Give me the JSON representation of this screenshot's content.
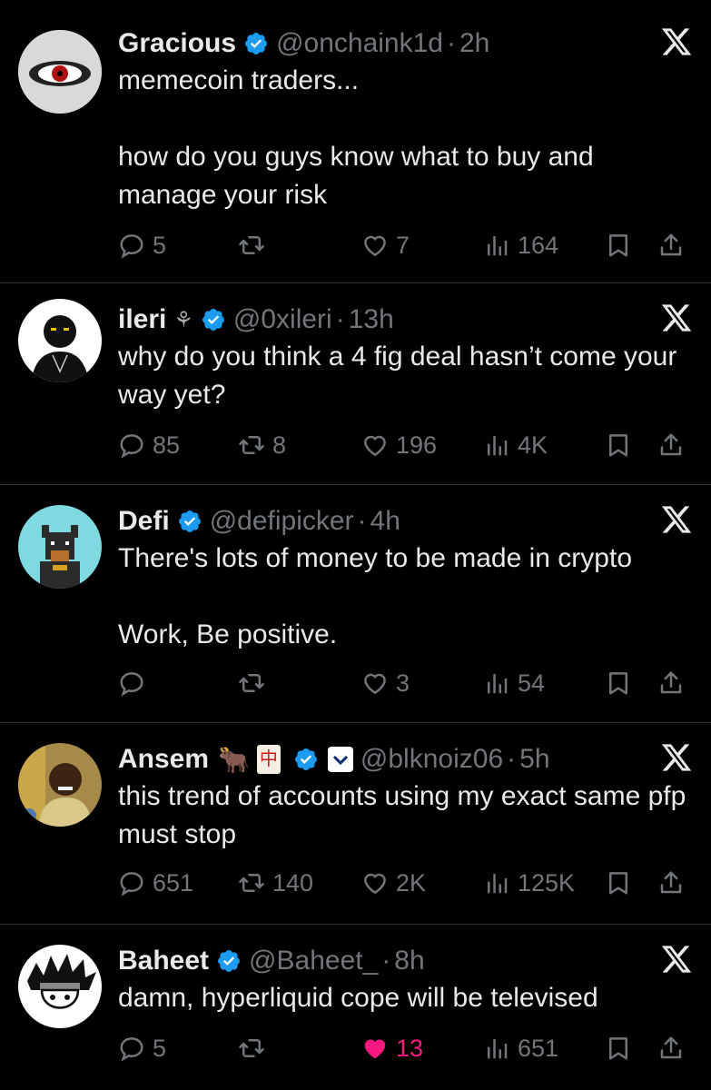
{
  "tweets": [
    {
      "name": "Gracious",
      "handle": "@onchaink1d",
      "time": "2h",
      "body": "memecoin traders...\n\nhow do you guys know what to buy and manage your risk",
      "replies": "5",
      "reposts": "",
      "likes": "7",
      "views": "164",
      "liked": false
    },
    {
      "name": "ileri",
      "handle": "@0xileri",
      "time": "13h",
      "body": "why do you think a 4 fig deal hasn’t come your way yet?",
      "replies": "85",
      "reposts": "8",
      "likes": "196",
      "views": "4K",
      "liked": false
    },
    {
      "name": "Defi",
      "handle": "@defipicker",
      "time": "4h",
      "body": "There's lots of money to be made in crypto\n\nWork, Be positive.",
      "replies": "",
      "reposts": "",
      "likes": "3",
      "views": "54",
      "liked": false
    },
    {
      "name": "Ansem",
      "handle": "@blknoiz06",
      "time": "5h",
      "body": "this trend of accounts using my exact same pfp must stop",
      "replies": "651",
      "reposts": "140",
      "likes": "2K",
      "views": "125K",
      "liked": false
    },
    {
      "name": "Baheet",
      "handle": "@Baheet_",
      "time": "8h",
      "body": "damn, hyperliquid cope will be televised",
      "replies": "5",
      "reposts": "",
      "likes": "13",
      "views": "651",
      "liked": true
    }
  ],
  "colors": {
    "background": "#000000",
    "text": "#e7e9ea",
    "muted": "#71767b",
    "verified": "#1d9bf0",
    "like": "#f91880",
    "divider": "#2f3336"
  },
  "icons": [
    "verified-badge-icon",
    "x-logo-icon",
    "reply-icon",
    "repost-icon",
    "like-icon",
    "views-icon",
    "bookmark-icon",
    "share-icon"
  ]
}
